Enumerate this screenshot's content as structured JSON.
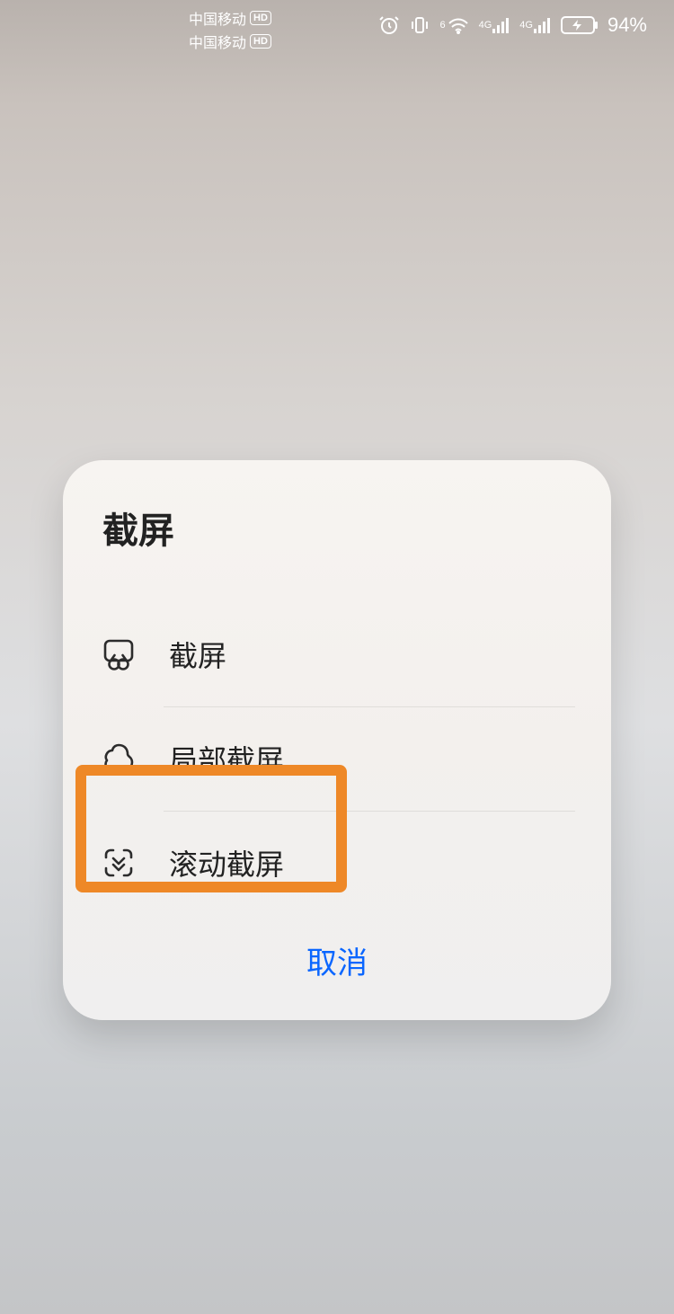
{
  "statusbar": {
    "carrier": "中国移动",
    "hd": "HD",
    "sup6": "6",
    "net_gen": "4G",
    "battery_percent": "94%"
  },
  "modal": {
    "title": "截屏",
    "items": [
      {
        "label": "截屏"
      },
      {
        "label": "局部截屏"
      },
      {
        "label": "滚动截屏"
      }
    ],
    "cancel": "取消"
  }
}
